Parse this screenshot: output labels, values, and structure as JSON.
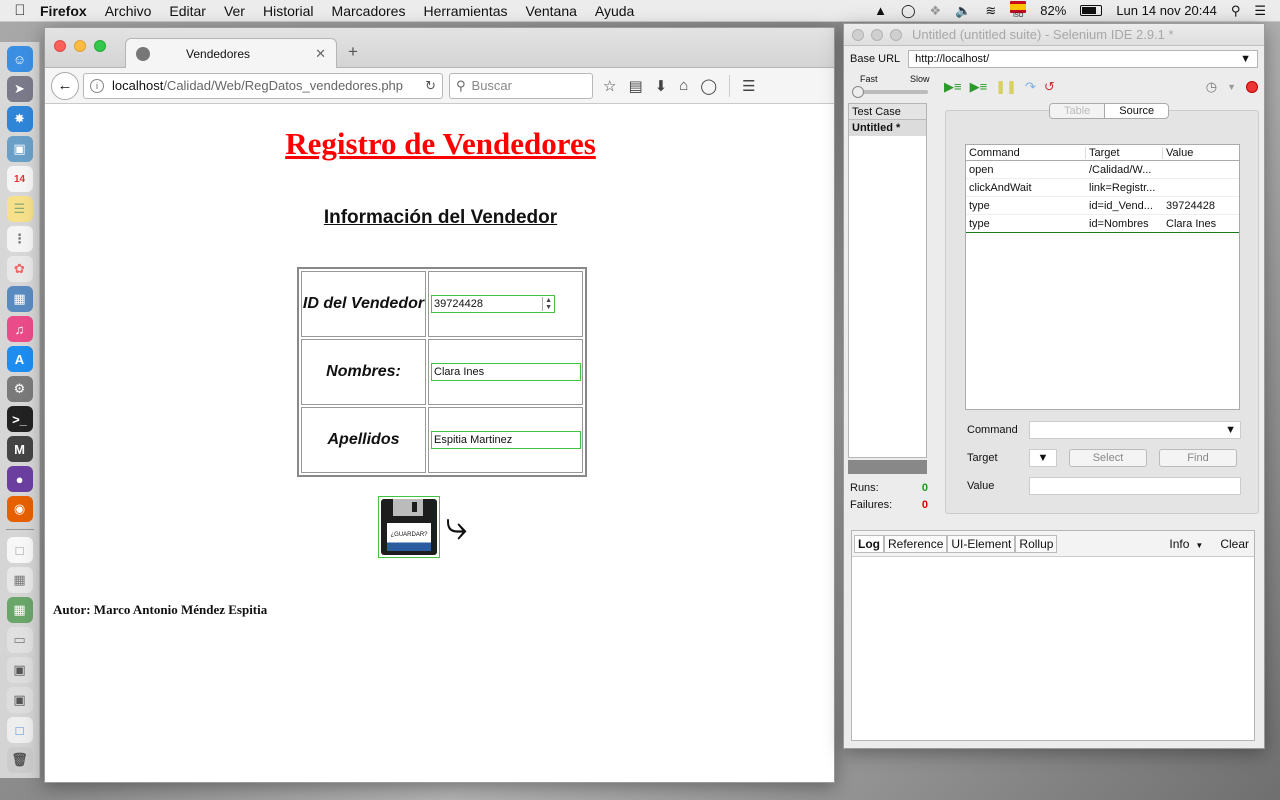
{
  "menubar": {
    "app": "Firefox",
    "items": [
      "Archivo",
      "Editar",
      "Ver",
      "Historial",
      "Marcadores",
      "Herramientas",
      "Ventana",
      "Ayuda"
    ],
    "battery": "82%",
    "datetime": "Lun 14 nov  20:44",
    "flag_label": "ISO"
  },
  "firefox": {
    "tab_title": "Vendedores",
    "url_host": "localhost",
    "url_path": "/Calidad/Web/RegDatos_vendedores.php",
    "search_placeholder": "Buscar"
  },
  "page": {
    "title": "Registro de Vendedores",
    "subtitle": "Información del Vendedor",
    "rows": [
      {
        "label": "ID del Vendedor",
        "value": "39724428"
      },
      {
        "label": "Nombres:",
        "value": "Clara Ines"
      },
      {
        "label": "Apellidos",
        "value": "Espitia Martinez"
      }
    ],
    "save_label": "¿GUARDAR?",
    "author": "Autor: Marco Antonio Méndez Espitia"
  },
  "selenium": {
    "title": "Untitled (untitled suite) - Selenium IDE 2.9.1 *",
    "base_url_label": "Base URL",
    "base_url": "http://localhost/",
    "speed_fast": "Fast",
    "speed_slow": "Slow",
    "test_case_header": "Test Case",
    "test_case_item": "Untitled *",
    "view_tabs": [
      "Table",
      "Source"
    ],
    "columns": [
      "Command",
      "Target",
      "Value"
    ],
    "commands": [
      {
        "command": "open",
        "target": "/Calidad/W...",
        "value": ""
      },
      {
        "command": "clickAndWait",
        "target": "link=Registr...",
        "value": ""
      },
      {
        "command": "type",
        "target": "id=id_Vend...",
        "value": "39724428"
      },
      {
        "command": "type",
        "target": "id=Nombres",
        "value": "Clara Ines"
      }
    ],
    "command_label": "Command",
    "target_label": "Target",
    "value_label": "Value",
    "select_btn": "Select",
    "find_btn": "Find",
    "runs_label": "Runs:",
    "runs": "0",
    "failures_label": "Failures:",
    "failures": "0",
    "log_tabs": [
      "Log",
      "Reference",
      "UI-Element",
      "Rollup"
    ],
    "info": "Info",
    "clear": "Clear"
  },
  "colors": {
    "title_red": "#ff0000",
    "input_border": "#44c244",
    "runs_green": "#1a9a1a",
    "failures_red": "#dd0000"
  }
}
